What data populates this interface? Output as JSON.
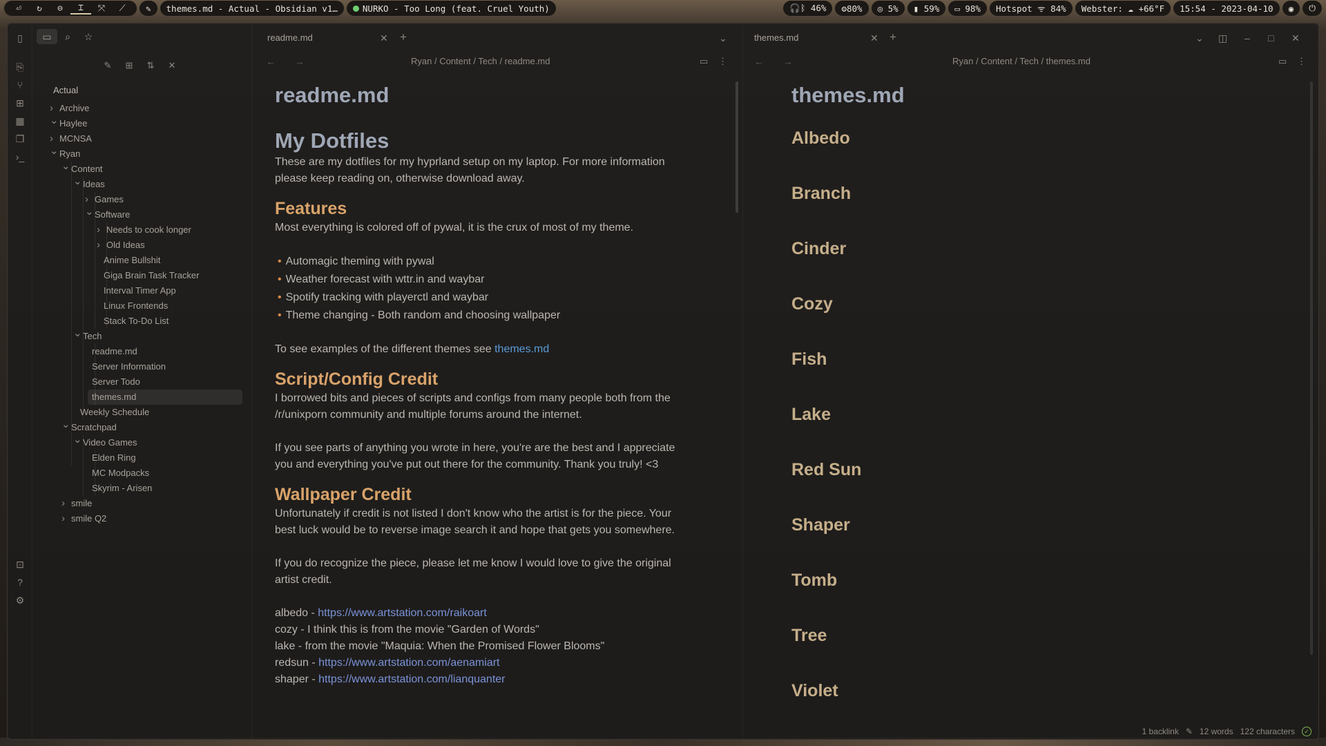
{
  "topbar": {
    "workspaces": [
      "⏎",
      "↻",
      "⊖",
      "⌶",
      "⤧",
      "⟋"
    ],
    "window_title": "themes.md - Actual - Obsidian v1…",
    "now_playing": "NURKO - Too Long (feat. Cruel Youth)",
    "headset": "🎧ᛒ 46%",
    "cpu": "⚙80%",
    "mem": "◎ 5%",
    "disk": "▮ 59%",
    "battery": "▭ 98%",
    "wifi": "Hotspot ᯤ 84%",
    "weather": "Webster: ☁ +66°F",
    "clock": "15:54 - 2023-04-10"
  },
  "sidebar": {
    "vault": "Actual",
    "tree": [
      {
        "label": "Archive",
        "type": "folder",
        "open": false,
        "depth": 0
      },
      {
        "label": "Haylee",
        "type": "folder",
        "open": true,
        "depth": 0
      },
      {
        "label": "MCNSA",
        "type": "folder",
        "open": false,
        "depth": 0
      },
      {
        "label": "Ryan",
        "type": "folder",
        "open": true,
        "depth": 0
      },
      {
        "label": "Content",
        "type": "folder",
        "open": true,
        "depth": 1
      },
      {
        "label": "Ideas",
        "type": "folder",
        "open": true,
        "depth": 2
      },
      {
        "label": "Games",
        "type": "folder",
        "open": false,
        "depth": 3
      },
      {
        "label": "Software",
        "type": "folder",
        "open": true,
        "depth": 3
      },
      {
        "label": "Needs to cook longer",
        "type": "folder",
        "open": false,
        "depth": 4
      },
      {
        "label": "Old Ideas",
        "type": "folder",
        "open": false,
        "depth": 4
      },
      {
        "label": "Anime Bullshit",
        "type": "file",
        "depth": 4
      },
      {
        "label": "Giga Brain Task Tracker",
        "type": "file",
        "depth": 4
      },
      {
        "label": "Interval Timer App",
        "type": "file",
        "depth": 4
      },
      {
        "label": "Linux Frontends",
        "type": "file",
        "depth": 4
      },
      {
        "label": "Stack To-Do List",
        "type": "file",
        "depth": 4
      },
      {
        "label": "Tech",
        "type": "folder",
        "open": true,
        "depth": 2
      },
      {
        "label": "readme.md",
        "type": "file",
        "depth": 3
      },
      {
        "label": "Server Information",
        "type": "file",
        "depth": 3
      },
      {
        "label": "Server Todo",
        "type": "file",
        "depth": 3
      },
      {
        "label": "themes.md",
        "type": "file",
        "depth": 3,
        "selected": true
      },
      {
        "label": "Weekly Schedule",
        "type": "file",
        "depth": 2
      },
      {
        "label": "Scratchpad",
        "type": "folder",
        "open": true,
        "depth": 1
      },
      {
        "label": "Video Games",
        "type": "folder",
        "open": true,
        "depth": 2
      },
      {
        "label": "Elden Ring",
        "type": "file",
        "depth": 3
      },
      {
        "label": "MC Modpacks",
        "type": "file",
        "depth": 3
      },
      {
        "label": "Skyrim - Arisen",
        "type": "file",
        "depth": 3
      },
      {
        "label": "smile",
        "type": "folder",
        "open": false,
        "depth": 1
      },
      {
        "label": "smile Q2",
        "type": "folder",
        "open": false,
        "depth": 1
      }
    ]
  },
  "left_pane": {
    "tab": "readme.md",
    "breadcrumb": [
      "Ryan",
      "Content",
      "Tech",
      "readme.md"
    ],
    "inline_title": "readme.md",
    "h1": "My Dotfiles",
    "intro_1": "These are my dotfiles for my hyprland setup on my laptop. For more information",
    "intro_2": "please keep reading on, otherwise download away.",
    "features_h": "Features",
    "features_p": "Most everything is colored off of pywal, it is the crux of most of my theme.",
    "features_list": [
      "Automagic theming with pywal",
      "Weather forecast with wttr.in and waybar",
      "Spotify tracking with playerctl and waybar",
      "Theme changing - Both random and choosing wallpaper"
    ],
    "examples_prefix": "To see examples of the different themes see ",
    "examples_link": "themes.md",
    "credit_h": "Script/Config Credit",
    "credit_1": "I borrowed bits and pieces of scripts and configs from many people both from the",
    "credit_2": "/r/unixporn community and multiple forums around the internet.",
    "credit_3": "If you see parts of anything you wrote in here, you're are the best and I appreciate",
    "credit_4": "you and everything you've put out there for the community. Thank you truly! <3",
    "wall_h": "Wallpaper Credit",
    "wall_1": "Unfortunately if credit is not listed I don't know who the artist is for the piece. Your",
    "wall_2": "best luck would be to reverse image search it and hope that gets you somewhere.",
    "wall_3": "If you do recognize the piece, please let me know I would love to give the original",
    "wall_4": "artist credit.",
    "credits": [
      {
        "prefix": "albedo - ",
        "link": "https://www.artstation.com/raikoart"
      },
      {
        "prefix": "cozy - I think this is from the movie \"Garden of Words\"",
        "link": ""
      },
      {
        "prefix": "lake - from the movie \"Maquia: When the Promised Flower Blooms\"",
        "link": ""
      },
      {
        "prefix": "redsun - ",
        "link": "https://www.artstation.com/aenamiart"
      },
      {
        "prefix": "shaper - ",
        "link": "https://www.artstation.com/lianquanter"
      }
    ]
  },
  "right_pane": {
    "tab": "themes.md",
    "breadcrumb": [
      "Ryan",
      "Content",
      "Tech",
      "themes.md"
    ],
    "inline_title": "themes.md",
    "themes": [
      "Albedo",
      "Branch",
      "Cinder",
      "Cozy",
      "Fish",
      "Lake",
      "Red Sun",
      "Shaper",
      "Tomb",
      "Tree",
      "Violet"
    ]
  },
  "status": {
    "backlinks": "1 backlink",
    "words": "12 words",
    "chars": "122 characters"
  }
}
